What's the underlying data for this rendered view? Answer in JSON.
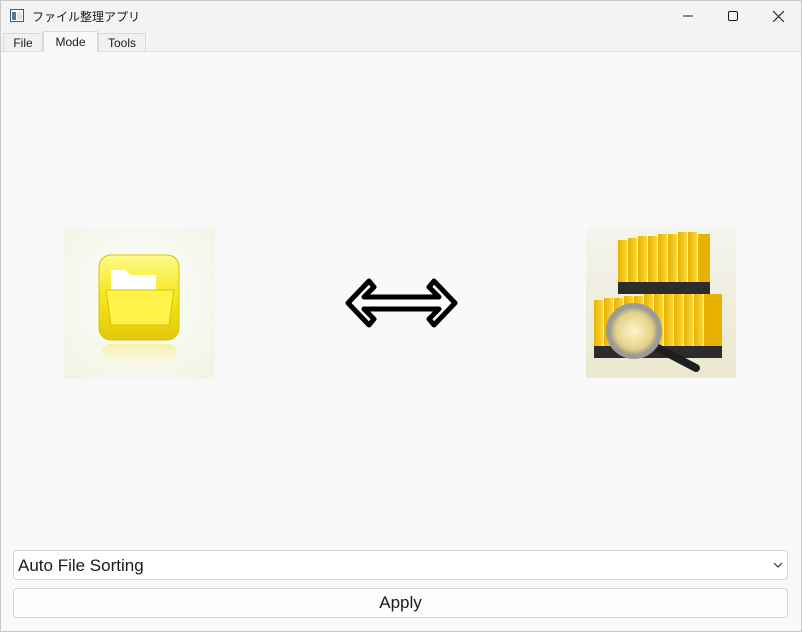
{
  "window": {
    "title": "ファイル整理アプリ"
  },
  "menu": {
    "tabs": [
      {
        "label": "File",
        "active": false
      },
      {
        "label": "Mode",
        "active": true
      },
      {
        "label": "Tools",
        "active": false
      }
    ]
  },
  "main": {
    "left_image": "folder-icon",
    "center_image": "double-arrow-icon",
    "right_image": "archive-binders-icon",
    "mode_select": {
      "selected": "Auto File Sorting"
    },
    "apply_label": "Apply"
  },
  "colors": {
    "accent_yellow": "#f2e21a",
    "window_bg": "#f9f9f9"
  }
}
